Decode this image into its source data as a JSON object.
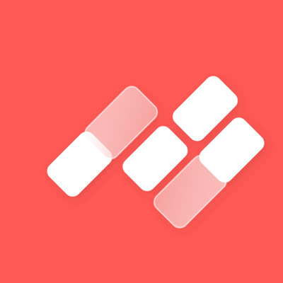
{
  "icon": {
    "name": "app-logo-icon",
    "description_name": "diagonal-blocks-logo",
    "colors": {
      "background": "#FF5A55",
      "block_white": "#FFFFFF",
      "block_tint": "#F7A6A3"
    }
  }
}
